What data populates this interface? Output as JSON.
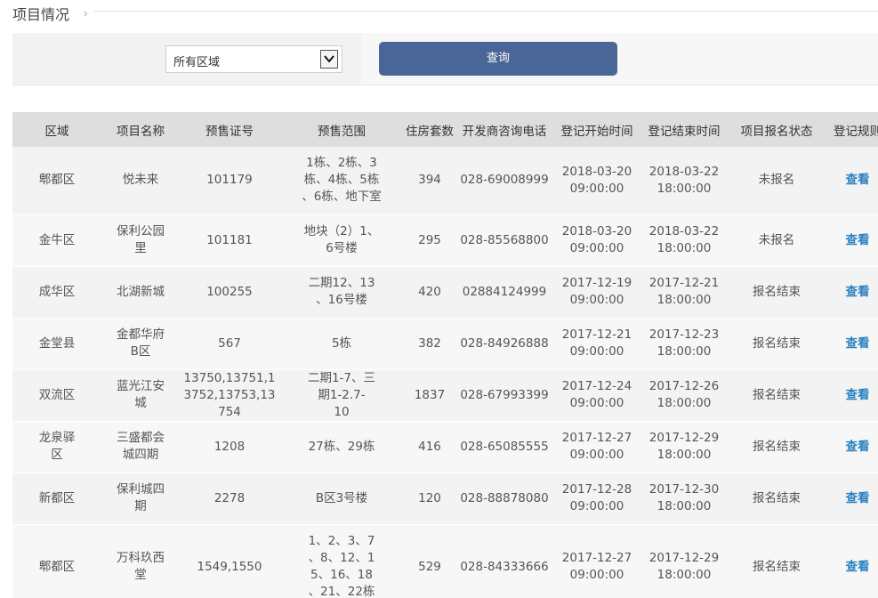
{
  "header": {
    "title": "项目情况",
    "chevron": "›"
  },
  "filter": {
    "region_value": "所有区域",
    "query_label": "查询"
  },
  "table": {
    "columns": [
      "区域",
      "项目名称",
      "预售证号",
      "预售范围",
      "住房套数",
      "开发商咨询电话",
      "登记开始时间",
      "登记结束时间",
      "项目报名状态",
      "登记规则"
    ],
    "rows": [
      {
        "district": "郫都区",
        "project": "悦未来",
        "permit": "101179",
        "scope": "1栋、2栋、3栋、4栋、5栋、6栋、地下室",
        "units": "394",
        "phone": "028-69008999",
        "start": "2018-03-20 09:00:00",
        "end": "2018-03-22 18:00:00",
        "status": "未报名",
        "rule": "查看"
      },
      {
        "district": "金牛区",
        "project": "保利公园里",
        "permit": "101181",
        "scope": "地块（2）1、6号楼",
        "units": "295",
        "phone": "028-85568800",
        "start": "2018-03-20 09:00:00",
        "end": "2018-03-22 18:00:00",
        "status": "未报名",
        "rule": "查看"
      },
      {
        "district": "成华区",
        "project": "北湖新城",
        "permit": "100255",
        "scope": "二期12、13、16号楼",
        "units": "420",
        "phone": "02884124999",
        "start": "2017-12-19 09:00:00",
        "end": "2017-12-21 18:00:00",
        "status": "报名结束",
        "rule": "查看"
      },
      {
        "district": "金堂县",
        "project": "金都华府B区",
        "permit": "567",
        "scope": "5栋",
        "units": "382",
        "phone": "028-84926888",
        "start": "2017-12-21 09:00:00",
        "end": "2017-12-23 18:00:00",
        "status": "报名结束",
        "rule": "查看"
      },
      {
        "district": "双流区",
        "project": "蓝光江安城",
        "permit": "13750,13751,13752,13753,13754",
        "scope": "二期1-7、三期1-2.7-10",
        "units": "1837",
        "phone": "028-67993399",
        "start": "2017-12-24 09:00:00",
        "end": "2017-12-26 18:00:00",
        "status": "报名结束",
        "rule": "查看"
      },
      {
        "district": "龙泉驿区",
        "project": "三盛都会城四期",
        "permit": "1208",
        "scope": "27栋、29栋",
        "units": "416",
        "phone": "028-65085555",
        "start": "2017-12-27 09:00:00",
        "end": "2017-12-29 18:00:00",
        "status": "报名结束",
        "rule": "查看"
      },
      {
        "district": "新都区",
        "project": "保利城四期",
        "permit": "2278",
        "scope": "B区3号楼",
        "units": "120",
        "phone": "028-88878080",
        "start": "2017-12-28 09:00:00",
        "end": "2017-12-30 18:00:00",
        "status": "报名结束",
        "rule": "查看"
      },
      {
        "district": "郫都区",
        "project": "万科玖西堂",
        "permit": "1549,1550",
        "scope": "1、2、3、7、8、12、15、16、18、21、22栋",
        "units": "529",
        "phone": "028-84333666",
        "start": "2017-12-27 09:00:00",
        "end": "2017-12-29 18:00:00",
        "status": "报名结束",
        "rule": "查看"
      }
    ]
  }
}
